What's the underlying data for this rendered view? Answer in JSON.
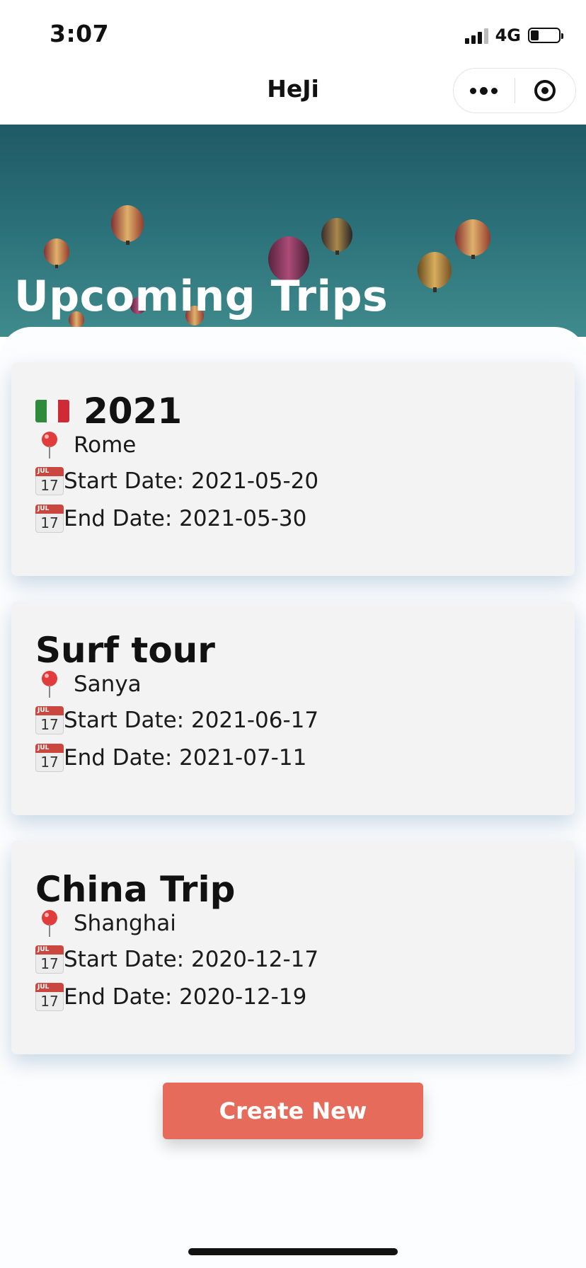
{
  "status_bar": {
    "time": "3:07",
    "network": "4G",
    "battery_level": 0.3
  },
  "nav": {
    "title": "HeJi"
  },
  "hero": {
    "title": "Upcoming Trips"
  },
  "trips": [
    {
      "title": "2021",
      "flag": "italy-flag",
      "location": "Rome",
      "start": "Start Date: 2021-05-20",
      "end": "End Date: 2021-05-30",
      "calendar_month": "JUL",
      "calendar_day": "17"
    },
    {
      "title": "Surf tour",
      "location": "Sanya",
      "start": "Start Date: 2021-06-17",
      "end": "End Date: 2021-07-11",
      "calendar_month": "JUL",
      "calendar_day": "17"
    },
    {
      "title": "China Trip",
      "location": "Shanghai",
      "start": "Start Date: 2020-12-17",
      "end": "End Date: 2020-12-19",
      "calendar_month": "JUL",
      "calendar_day": "17"
    }
  ],
  "create_button": {
    "label": "Create New"
  },
  "colors": {
    "accent": "#e76b5b",
    "card_bg": "#f3f3f3",
    "hero_sky": "#2a6f78",
    "italy_green": "#2f8a3c",
    "italy_white": "#f6f6f6",
    "italy_red": "#cf2b37"
  }
}
